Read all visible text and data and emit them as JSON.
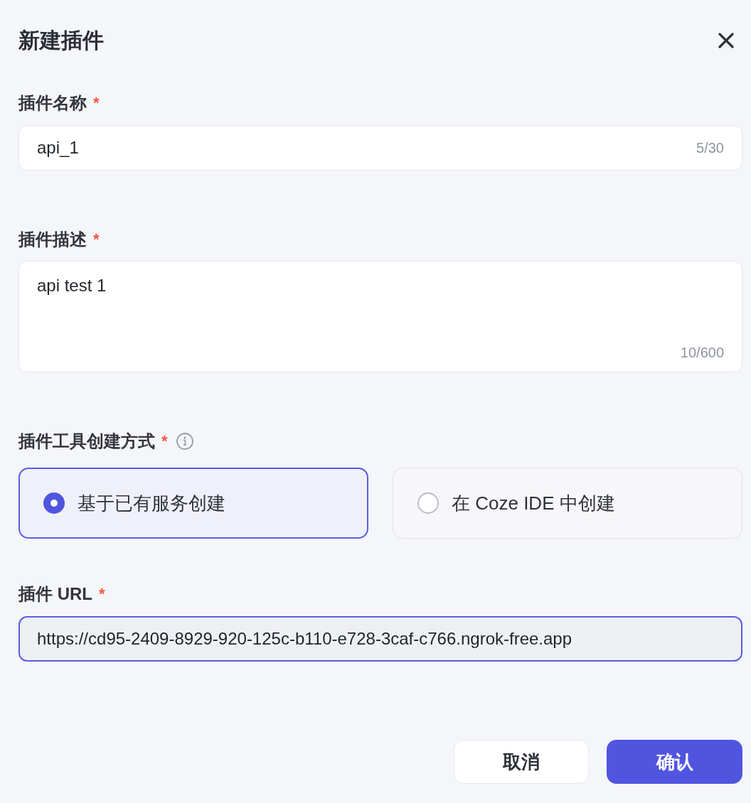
{
  "dialog": {
    "title": "新建插件"
  },
  "fields": [
    {
      "kind": "input",
      "label": "插件名称",
      "required_mark": "*",
      "value": "api_1",
      "counter": "5/30",
      "focused": false
    },
    {
      "kind": "textarea",
      "label": "插件描述",
      "required_mark": "*",
      "value": "api test 1",
      "counter": "10/600",
      "focused": false
    },
    {
      "kind": "choice",
      "label": "插件工具创建方式",
      "required_mark": "*",
      "info": true,
      "options": [
        {
          "label": "基于已有服务创建",
          "selected": true
        },
        {
          "label": "在 Coze IDE 中创建",
          "selected": false
        }
      ]
    },
    {
      "kind": "input",
      "label": "插件 URL",
      "required_mark": "*",
      "value": "https://cd95-2409-8929-920-125c-b110-e728-3caf-c766.ngrok-free.app",
      "focused": true
    }
  ],
  "buttons": [
    {
      "kind": "cancel",
      "label": "取消"
    },
    {
      "kind": "confirm",
      "label": "确认"
    }
  ]
}
